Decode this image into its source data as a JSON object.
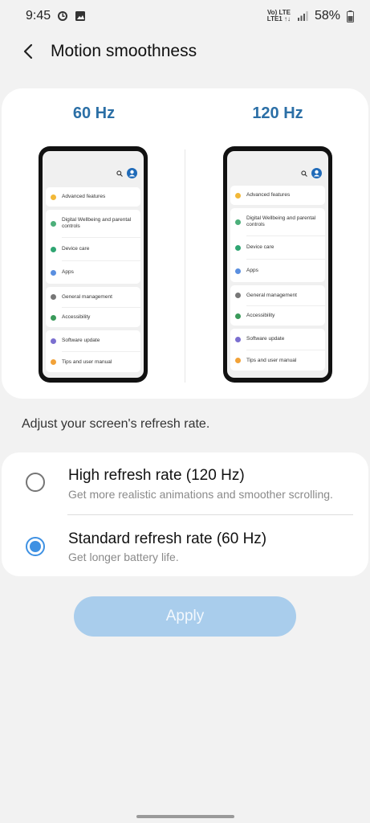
{
  "status_bar": {
    "time": "9:45",
    "network_top": "Vo) LTE",
    "network_bottom": "LTE1 ↑↓",
    "battery": "58%"
  },
  "header": {
    "title": "Motion smoothness",
    "back_icon": "back-arrow-icon"
  },
  "preview": {
    "left_label": "60 Hz",
    "right_label": "120 Hz",
    "phone_items": {
      "advanced": "Advanced features",
      "wellbeing_1": "Digital Wellbeing and parental",
      "wellbeing_2": "controls",
      "device_care": "Device care",
      "apps": "Apps",
      "general": "General management",
      "accessibility": "Accessibility",
      "software": "Software update",
      "tips": "Tips and user manual"
    }
  },
  "description": "Adjust your screen's refresh rate.",
  "options": [
    {
      "title": "High refresh rate (120 Hz)",
      "subtitle": "Get more realistic animations and smoother scrolling.",
      "selected": false
    },
    {
      "title": "Standard refresh rate (60 Hz)",
      "subtitle": "Get longer battery life.",
      "selected": true
    }
  ],
  "apply_label": "Apply",
  "colors": {
    "accent": "#3e91e3",
    "hz_label": "#2b6fa6",
    "apply_bg": "#a9cdec"
  }
}
